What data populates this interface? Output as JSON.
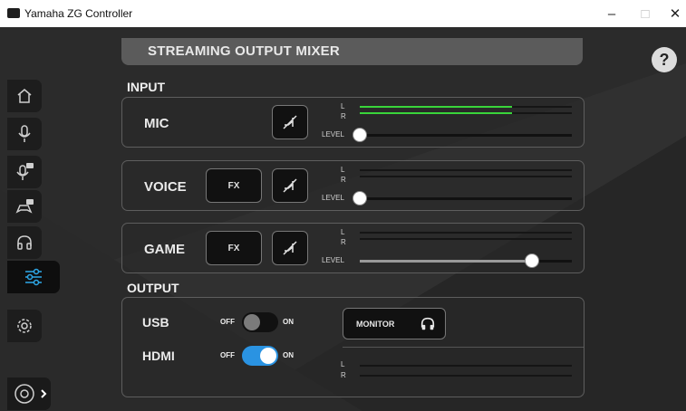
{
  "window": {
    "title": "Yamaha ZG Controller",
    "minimize": "–",
    "maximize": "□",
    "close": "✕"
  },
  "header": {
    "title": "STREAMING OUTPUT MIXER",
    "help": "?"
  },
  "input": {
    "label": "INPUT",
    "channels": [
      {
        "name": "MIC",
        "meter_l": 0.72,
        "meter_r": 0.72,
        "level": 0.0,
        "has_fx": false
      },
      {
        "name": "VOICE",
        "fx": "FX",
        "meter_l": 0.0,
        "meter_r": 0.0,
        "level": 0.0,
        "has_fx": true
      },
      {
        "name": "GAME",
        "fx": "FX",
        "meter_l": 0.0,
        "meter_r": 0.0,
        "level": 0.81,
        "has_fx": true
      }
    ],
    "meter_l": "L",
    "meter_r": "R",
    "level_label": "LEVEL"
  },
  "output": {
    "label": "OUTPUT",
    "usb": {
      "label": "USB",
      "off": "OFF",
      "on": "ON",
      "state": "off"
    },
    "hdmi": {
      "label": "HDMI",
      "off": "OFF",
      "on": "ON",
      "state": "on"
    },
    "monitor": {
      "label": "MONITOR",
      "icon": "headphones-icon"
    },
    "meter_l": "L",
    "meter_r": "R"
  },
  "colors": {
    "meter_green": "#39d53a",
    "toggle_on": "#2a93e2",
    "active_icon": "#2ea8e8"
  },
  "sidebar": [
    "home-icon",
    "microphone-icon",
    "mic-fx-icon",
    "gamepad-fx-icon",
    "headphones-icon",
    "mixer-sliders-icon",
    "gear-icon"
  ]
}
